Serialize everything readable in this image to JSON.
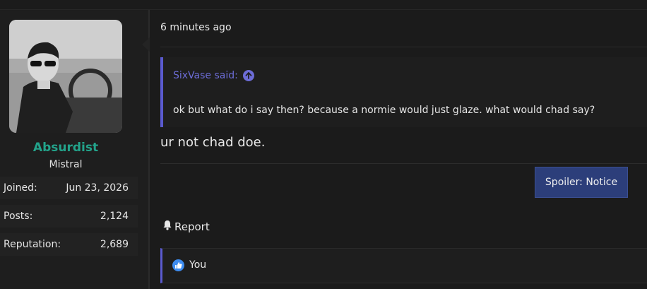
{
  "post": {
    "timestamp": "6 minutes ago",
    "quote": {
      "author": "SixVase said:",
      "text": "ok but what do i say then? because a normie would just glaze. what would chad say?"
    },
    "message": "ur not chad doe.",
    "spoiler_label": "Spoiler: Notice",
    "report_label": "Report",
    "reactions_label": "You"
  },
  "author": {
    "username": "Absurdist",
    "title": "Mistral",
    "stats": [
      {
        "label": "Joined:",
        "value": "Jun 23, 2026"
      },
      {
        "label": "Posts:",
        "value": "2,124"
      },
      {
        "label": "Reputation:",
        "value": "2,689"
      }
    ]
  },
  "colors": {
    "username": "#23a38b",
    "quote_accent": "#5a5acf",
    "spoiler_bg": "#2c3e7a",
    "like_icon": "#3d8cf0"
  }
}
